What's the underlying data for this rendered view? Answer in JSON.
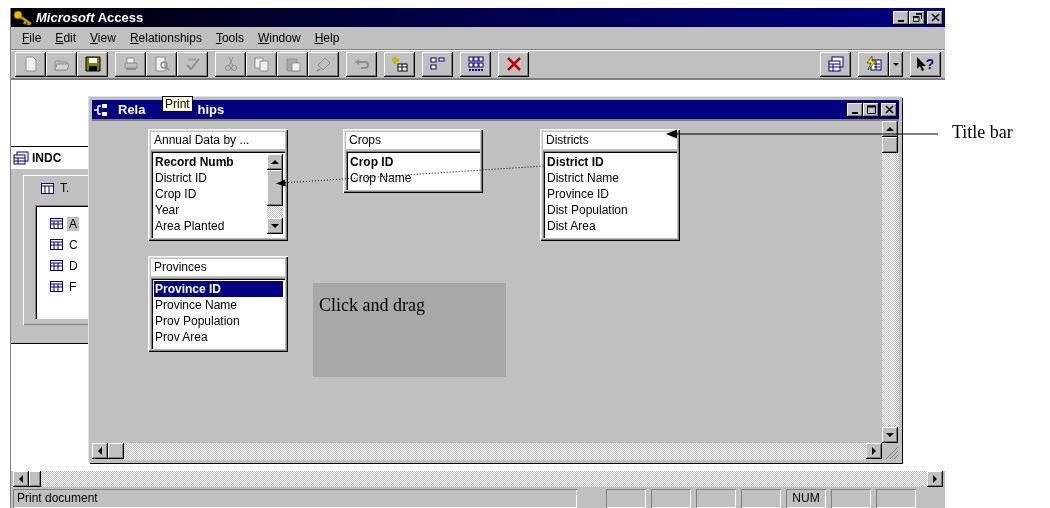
{
  "app_window": {
    "title": "*Microsoft* Access"
  },
  "menu": [
    {
      "key": "F",
      "rest": "ile"
    },
    {
      "key": "E",
      "rest": "dit"
    },
    {
      "key": "V",
      "rest": "iew"
    },
    {
      "key": "R",
      "rest": "elationships"
    },
    {
      "key": "T",
      "rest": "ools"
    },
    {
      "key": "W",
      "rest": "indow"
    },
    {
      "key": "H",
      "rest": "elp"
    }
  ],
  "toolbar": [
    {
      "kind": "new",
      "disabled": true,
      "gap_before": false
    },
    {
      "kind": "open",
      "disabled": true,
      "gap_before": false
    },
    {
      "kind": "save",
      "disabled": false,
      "gap_before": false
    },
    {
      "kind": "print",
      "disabled": true,
      "gap_before": true
    },
    {
      "kind": "preview",
      "disabled": true,
      "gap_before": false
    },
    {
      "kind": "spelling",
      "disabled": true,
      "gap_before": false
    },
    {
      "kind": "cut",
      "disabled": true,
      "gap_before": true
    },
    {
      "kind": "copy",
      "disabled": true,
      "gap_before": false
    },
    {
      "kind": "paste",
      "disabled": true,
      "gap_before": false
    },
    {
      "kind": "painter",
      "disabled": true,
      "gap_before": false
    },
    {
      "kind": "undo",
      "disabled": true,
      "gap_before": true
    },
    {
      "kind": "show-table",
      "disabled": false,
      "gap_before": true
    },
    {
      "kind": "show-direct",
      "disabled": false,
      "gap_before": true
    },
    {
      "kind": "show-all",
      "disabled": false,
      "gap_before": true
    },
    {
      "kind": "delete",
      "disabled": false,
      "gap_before": true
    }
  ],
  "toolbar_right": [
    {
      "kind": "database-window",
      "disabled": false,
      "gap_before": false
    },
    {
      "kind": "new-object",
      "disabled": false,
      "gap_before": true
    },
    {
      "kind": "dropdown",
      "disabled": false,
      "gap_before": false
    },
    {
      "kind": "help",
      "disabled": false,
      "gap_before": true,
      "symbol": "?"
    }
  ],
  "database_window": {
    "title": "INDC",
    "tab": "T.",
    "items": [
      {
        "label": "A",
        "selected": true
      },
      {
        "label": "C",
        "selected": false
      },
      {
        "label": "D",
        "selected": false
      },
      {
        "label": "F",
        "selected": false
      }
    ]
  },
  "tooltip": {
    "text": "Print"
  },
  "relationships_window": {
    "title_start": "Rela",
    "title_end": "hips",
    "tables": [
      {
        "title": "Annual Data by ...",
        "scrollbar": true,
        "fields": [
          {
            "name": "Record Numb",
            "key": true,
            "selected": false
          },
          {
            "name": "District ID",
            "key": false,
            "selected": false
          },
          {
            "name": "Crop ID",
            "key": false,
            "selected": false
          },
          {
            "name": "Year",
            "key": false,
            "selected": false
          },
          {
            "name": "Area Planted",
            "key": false,
            "selected": false
          }
        ]
      },
      {
        "title": "Crops",
        "scrollbar": false,
        "fields": [
          {
            "name": "Crop ID",
            "key": true,
            "selected": false
          },
          {
            "name": "Crop Name",
            "key": false,
            "selected": false
          }
        ]
      },
      {
        "title": "Districts",
        "scrollbar": false,
        "fields": [
          {
            "name": "District ID",
            "key": true,
            "selected": false
          },
          {
            "name": "District Name",
            "key": false,
            "selected": false
          },
          {
            "name": "Province ID",
            "key": false,
            "selected": false
          },
          {
            "name": "Dist Population",
            "key": false,
            "selected": false
          },
          {
            "name": "Dist Area",
            "key": false,
            "selected": false
          }
        ]
      },
      {
        "title": "Provinces",
        "scrollbar": false,
        "fields": [
          {
            "name": "Province ID",
            "key": true,
            "selected": true
          },
          {
            "name": "Province Name",
            "key": false,
            "selected": false
          },
          {
            "name": "Prov Population",
            "key": false,
            "selected": false
          },
          {
            "name": "Prov Area",
            "key": false,
            "selected": false
          }
        ]
      }
    ]
  },
  "callout": {
    "text": "Click and drag"
  },
  "annotation": {
    "text": "Title bar"
  },
  "status_bar": {
    "message": "Print document",
    "indicators": [
      {
        "kind": "empty"
      },
      {
        "kind": "empty"
      },
      {
        "kind": "empty"
      },
      {
        "kind": "empty"
      },
      {
        "kind": "text",
        "label": "NUM"
      },
      {
        "kind": "empty"
      },
      {
        "kind": "empty"
      }
    ]
  }
}
